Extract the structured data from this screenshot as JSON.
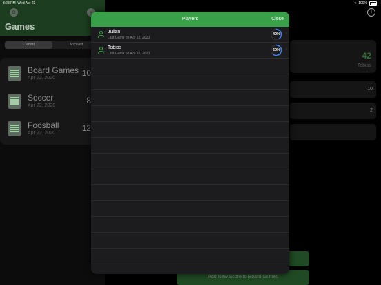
{
  "status": {
    "time": "3:28 PM",
    "date": "Wed Apr 22",
    "battery": "100%"
  },
  "sidebar": {
    "title": "Games",
    "segments": [
      "Current",
      "Archived"
    ],
    "games": [
      {
        "name": "Board Games",
        "date": "Apr 22, 2020",
        "count": "10"
      },
      {
        "name": "Soccer",
        "date": "Apr 22, 2020",
        "count": "8"
      },
      {
        "name": "Foosball",
        "date": "Apr 22, 2020",
        "count": "12"
      }
    ]
  },
  "detail": {
    "score": "42",
    "leader": "Tobias",
    "rows": [
      "10",
      "2"
    ],
    "add_button": "Add New Score to Board Games"
  },
  "modal": {
    "title": "Players",
    "close": "Close",
    "players": [
      {
        "name": "Julian",
        "last": "Last Game on Apr 22, 2020",
        "percent": "40%",
        "progress": 0.4
      },
      {
        "name": "Tobias",
        "last": "Last Game on Apr 22, 2020",
        "percent": "60%",
        "progress": 0.6
      }
    ]
  },
  "colors": {
    "accent": "#39a04a",
    "ring": "#3b82f6"
  }
}
